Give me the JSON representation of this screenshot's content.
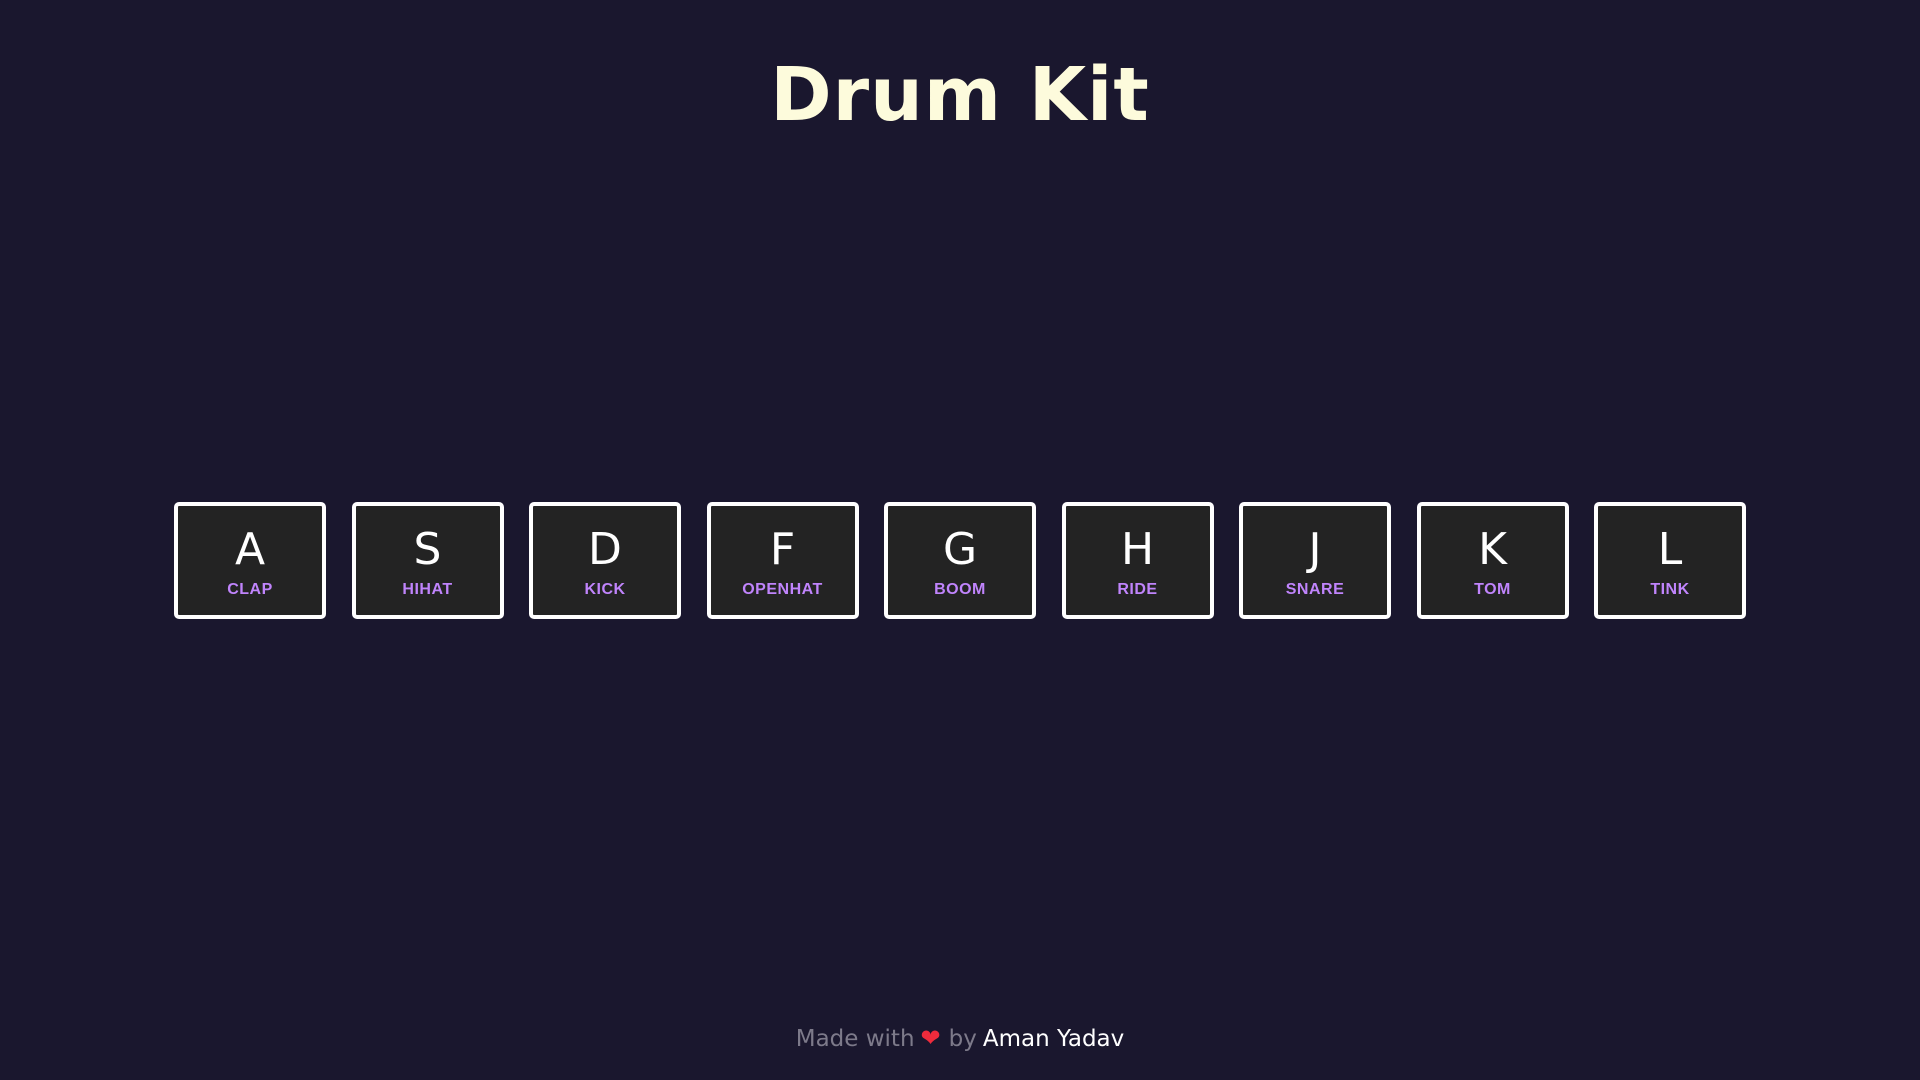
{
  "page": {
    "title": "Drum Kit"
  },
  "keys": [
    {
      "key": "A",
      "sound": "CLAP"
    },
    {
      "key": "S",
      "sound": "HIHAT"
    },
    {
      "key": "D",
      "sound": "KICK"
    },
    {
      "key": "F",
      "sound": "OPENHAT"
    },
    {
      "key": "G",
      "sound": "BOOM"
    },
    {
      "key": "H",
      "sound": "RIDE"
    },
    {
      "key": "J",
      "sound": "SNARE"
    },
    {
      "key": "K",
      "sound": "TOM"
    },
    {
      "key": "L",
      "sound": "TINK"
    }
  ],
  "footer": {
    "made_with": "Made with",
    "heart_icon": "❤",
    "by": "by",
    "author": "Aman Yadav"
  },
  "colors": {
    "background": "#1a172e",
    "title": "#fdfbdc",
    "key_border": "#ffffff",
    "key_background": "#232323",
    "sound_label": "#c084fc",
    "footer_text": "#7d7a8a",
    "heart": "#ef2b3c"
  }
}
